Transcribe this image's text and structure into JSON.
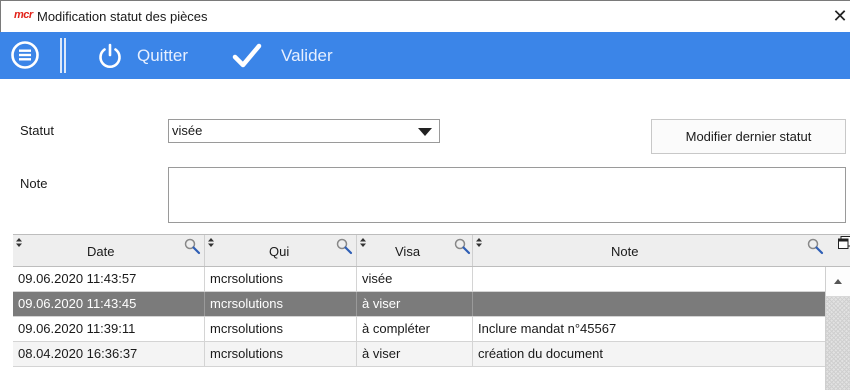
{
  "window": {
    "app_logo": "mcr",
    "title": "Modification statut des pièces",
    "close_icon": "close-icon"
  },
  "toolbar": {
    "menu_icon": "hamburger-menu-icon",
    "quit_icon": "power-icon",
    "quit_label": "Quitter",
    "validate_icon": "checkmark-icon",
    "validate_label": "Valider",
    "background_color": "#3b85e8"
  },
  "form": {
    "status_label": "Statut",
    "status_value": "visée",
    "modify_button": "Modifier dernier statut",
    "note_label": "Note",
    "note_value": ""
  },
  "grid": {
    "columns": [
      "Date",
      "Qui",
      "Visa",
      "Note"
    ],
    "rows": [
      {
        "date": "09.06.2020 11:43:57",
        "qui": "mcrsolutions",
        "visa": "visée",
        "note": ""
      },
      {
        "date": "09.06.2020 11:43:45",
        "qui": "mcrsolutions",
        "visa": "à viser",
        "note": ""
      },
      {
        "date": "09.06.2020 11:39:11",
        "qui": "mcrsolutions",
        "visa": "à compléter",
        "note": "Inclure mandat n°45567"
      },
      {
        "date": "08.04.2020 16:36:37",
        "qui": "mcrsolutions",
        "visa": "à viser",
        "note": "création du document"
      }
    ],
    "selected_row": 2,
    "selected_color": "#7b7b7b"
  }
}
